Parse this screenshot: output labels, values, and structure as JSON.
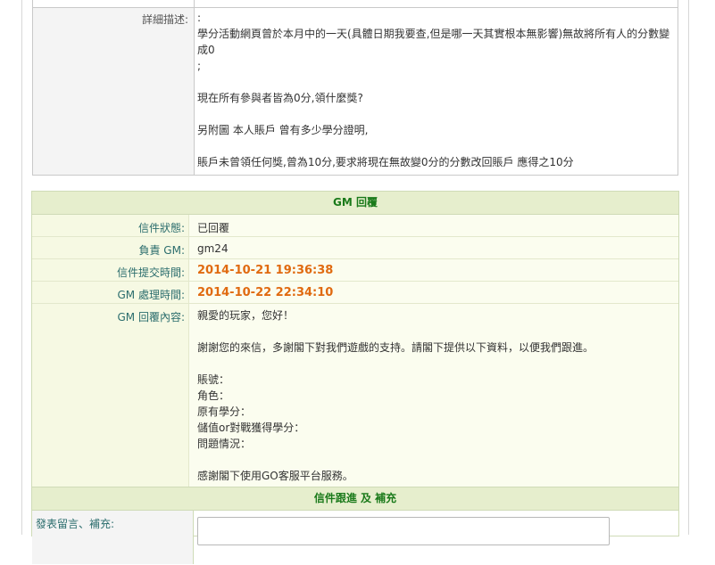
{
  "detail": {
    "label": "詳細描述:",
    "lines": [
      ":",
      "學分活動網頁曾於本月中的一天(具體日期我要查,但是哪一天其實根本無影響)無故將所有人的分數變",
      "成0",
      ";",
      "",
      "現在所有參與者皆為0分,領什麼獎?",
      "",
      "另附圖 本人賬戶 曾有多少學分證明,",
      "",
      "賬戶未曾領任何獎,曾為10分,要求將現在無故變0分的分數改回賬戶 應得之10分"
    ]
  },
  "gm_reply": {
    "header": "GM 回覆",
    "status_label": "信件狀態:",
    "status_value": "已回覆",
    "gm_label": "負責 GM:",
    "gm_value": "gm24",
    "submit_label": "信件提交時間:",
    "submit_value": "2014-10-21 19:36:38",
    "process_label": "GM 處理時間:",
    "process_value": "2014-10-22 22:34:10",
    "content_label": "GM 回覆內容:",
    "content_lines": [
      "親愛的玩家，您好！",
      "",
      "謝謝您的來信，多謝閣下對我們遊戲的支持。請閣下提供以下資料，以便我們跟進。",
      "",
      "賬號：",
      "角色：",
      "原有學分：",
      "儲值or對戰獲得學分：",
      "問題情況：",
      "",
      "感謝閣下使用GO客服平台服務。"
    ]
  },
  "followup": {
    "header": "信件跟進 及 補充",
    "label": "發表留言、補充:",
    "input_value": ""
  }
}
